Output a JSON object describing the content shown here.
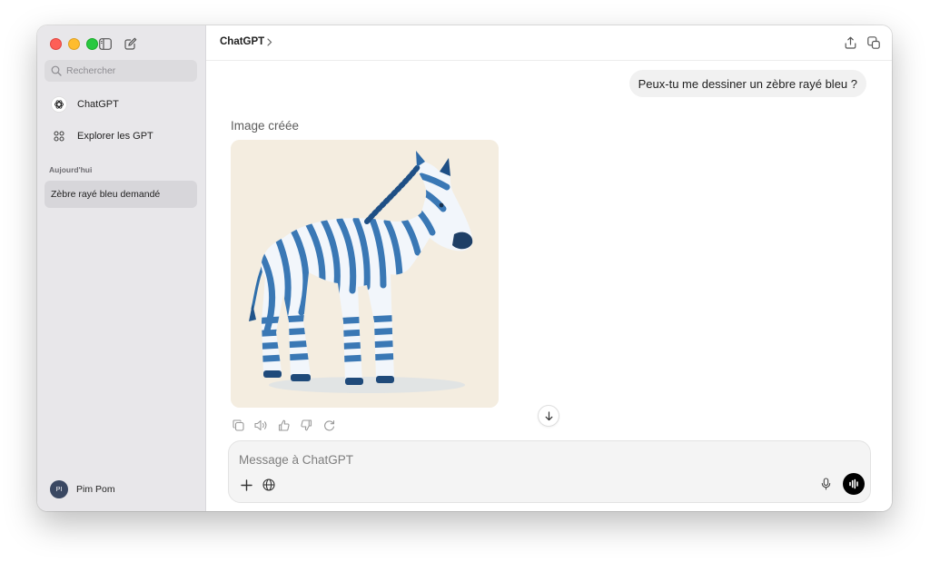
{
  "window": {
    "traffic_lights": [
      "close",
      "minimize",
      "zoom"
    ]
  },
  "sidebar": {
    "toggle_icon": "sidebar-toggle-icon",
    "new_chat_icon": "compose-icon",
    "search": {
      "placeholder": "Rechercher",
      "value": ""
    },
    "nav": [
      {
        "label": "ChatGPT",
        "icon": "chatgpt-logo-icon"
      },
      {
        "label": "Explorer les GPT",
        "icon": "grid-icon"
      }
    ],
    "section_label": "Aujourd'hui",
    "chats": [
      {
        "label": "Zèbre rayé bleu demandé",
        "selected": true
      }
    ],
    "user": {
      "initials": "PI",
      "name": "Pim Pom"
    }
  },
  "header": {
    "model_name": "ChatGPT",
    "share_icon": "share-icon",
    "new_window_icon": "new-window-icon"
  },
  "conversation": {
    "user_message": "Peux-tu me dessiner un zèbre rayé bleu ?",
    "assistant_caption": "Image créée",
    "image_subject": "blue-striped zebra illustration",
    "action_icons": [
      "copy-icon",
      "read-aloud-icon",
      "thumbs-up-icon",
      "thumbs-down-icon",
      "regenerate-icon"
    ]
  },
  "composer": {
    "placeholder": "Message à ChatGPT",
    "value": "",
    "attach_icon": "plus-icon",
    "search_icon": "globe-icon",
    "mic_icon": "microphone-icon",
    "voice_icon": "voice-mode-icon"
  },
  "colors": {
    "sidebar_bg": "#e8e7ea",
    "selected_chat_bg": "#d7d6da",
    "user_bubble_bg": "#f1f1f1",
    "zebra_blue": "#3a78b5",
    "image_bg": "#f4ede0"
  }
}
